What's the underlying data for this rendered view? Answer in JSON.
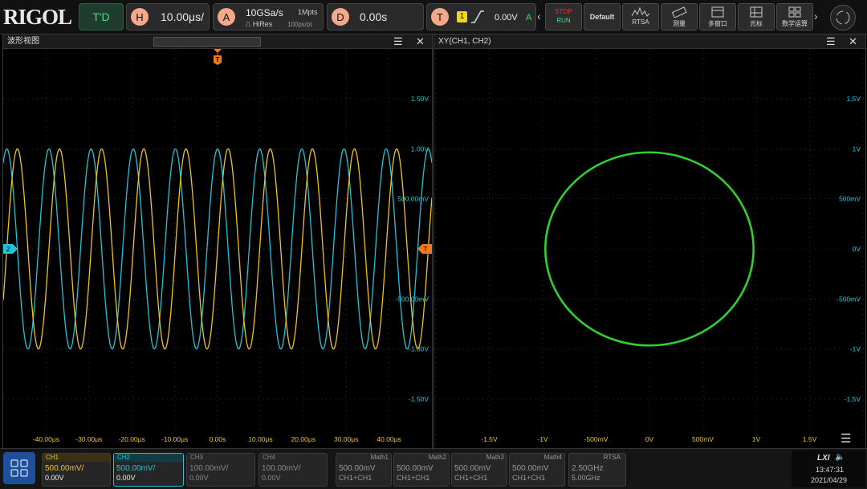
{
  "brand": {
    "logo": "RIGOL",
    "mode": "T'D"
  },
  "horizontal": {
    "badge": "H",
    "scale": "10.00μs/"
  },
  "acquire": {
    "badge": "A",
    "rate": "10GSa/s",
    "depth": "1Mpts",
    "mode": "HiRes",
    "res": "100ps/pt"
  },
  "delay": {
    "badge": "D",
    "value": "0.00s"
  },
  "trigger": {
    "badge": "T",
    "source": "1",
    "level": "0.00V",
    "mode": "A"
  },
  "toolbar": {
    "stop": "STOP",
    "run": "RUN",
    "default": "Default",
    "rtsa": "RTSA",
    "measure": "测量",
    "multiwin": "多窗口",
    "cursor": "光标",
    "math": "数学运算"
  },
  "waveform_panel": {
    "title": "波形视图",
    "trigger_marker": "T",
    "ch2_marker": "2",
    "y_labels": [
      "1.50V",
      "1.00V",
      "500.00mV",
      "0.0",
      "-500.00mV",
      "-1.00V",
      "-1.50V"
    ],
    "x_labels": [
      "-40.00μs",
      "-30.00μs",
      "-20.00μs",
      "-10.00μs",
      "0.00s",
      "10.00μs",
      "20.00μs",
      "30.00μs",
      "40.00μs"
    ]
  },
  "xy_panel": {
    "title": "XY(CH1, CH2)",
    "y_labels": [
      "1.5V",
      "1V",
      "500mV",
      "0V",
      "-500mV",
      "-1V",
      "-1.5V"
    ],
    "x_labels": [
      "-1.5V",
      "-1V",
      "-500mV",
      "0V",
      "500mV",
      "1V",
      "1.5V"
    ]
  },
  "channels": [
    {
      "name": "CH1",
      "scale": "500.00mV/",
      "offset": "0.00V"
    },
    {
      "name": "CH2",
      "scale": "500.00mV/",
      "offset": "0.00V"
    },
    {
      "name": "CH3",
      "scale": "100.00mV/",
      "offset": "0.00V"
    },
    {
      "name": "CH4",
      "scale": "100.00mV/",
      "offset": "0.00V"
    }
  ],
  "maths": [
    {
      "name": "Math1",
      "scale": "500.00mV",
      "src": "CH1+CH1"
    },
    {
      "name": "Math2",
      "scale": "500.00mV",
      "src": "CH1+CH1"
    },
    {
      "name": "Math3",
      "scale": "500.00mV",
      "src": "CH1+CH1"
    },
    {
      "name": "Math4",
      "scale": "500.00mV",
      "src": "CH1+CH1"
    }
  ],
  "rtsa": {
    "name": "RTSA",
    "center": "2.50GHz",
    "span": "5.00GHz"
  },
  "status": {
    "lxi": "LXI",
    "time": "13:47:31",
    "date": "2021/04/29"
  },
  "colors": {
    "ch1": "#f0c419",
    "ch2": "#22c4d8",
    "xy": "#2fd12f",
    "trigger": "#f07b1e",
    "grid": "#4a4a4a"
  }
}
